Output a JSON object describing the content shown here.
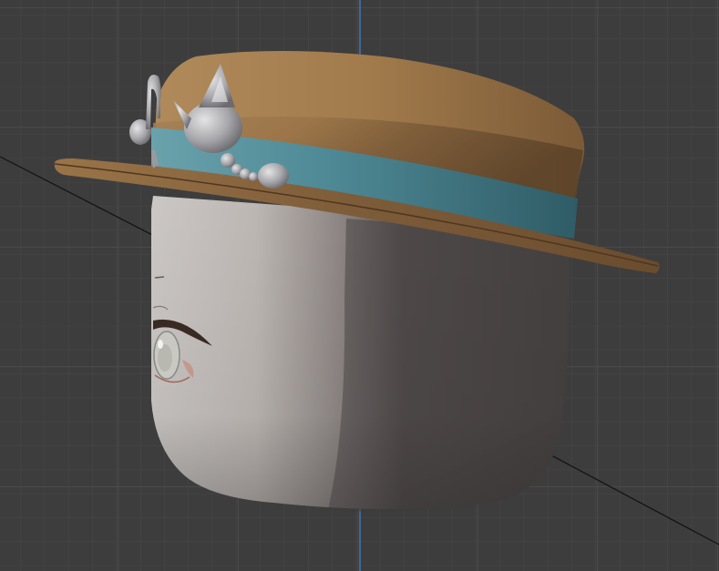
{
  "viewport": {
    "background_color": "#3d3d3d",
    "grid_color": "#4a4a4a",
    "z_axis_color": "#3f7fd0",
    "ground_line_color": "#111111"
  },
  "model": {
    "head_color": "#a39e9b",
    "hat_crown_color": "#8a6a44",
    "hat_brim_color": "#7a5a38",
    "hat_band_color": "#4f8a96",
    "ornament_color": "#b8b8bc",
    "eye_iris_color": "#c9c9c3"
  }
}
